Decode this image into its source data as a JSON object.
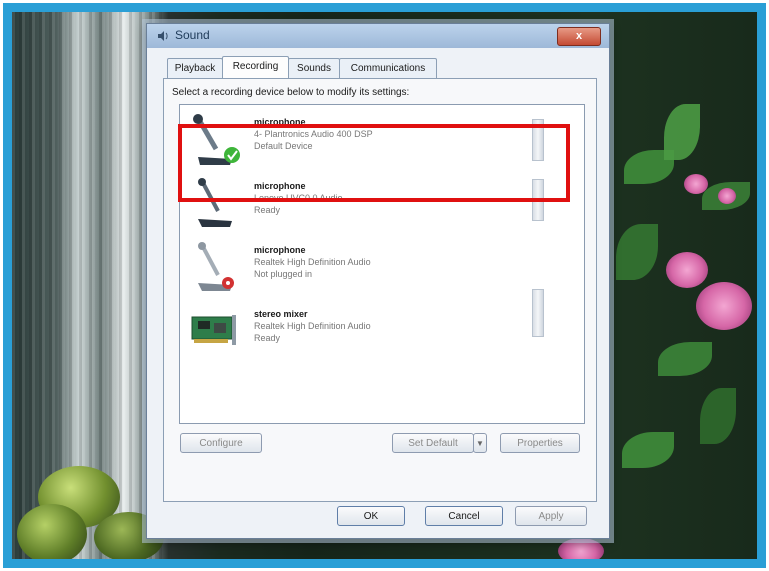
{
  "window": {
    "title": "Sound",
    "close_glyph": "x"
  },
  "tabs": [
    {
      "label": "Playback"
    },
    {
      "label": "Recording"
    },
    {
      "label": "Sounds"
    },
    {
      "label": "Communications"
    }
  ],
  "recording": {
    "instruction": "Select a recording device below to modify its settings:",
    "devices": [
      {
        "name": "microphone",
        "description": "4- Plantronics Audio 400 DSP",
        "status": "Default Device"
      },
      {
        "name": "microphone",
        "description": "Lenovo UVC0.0 Audio",
        "status": "Ready"
      },
      {
        "name": "microphone",
        "description": "Realtek High Definition Audio",
        "status": "Not plugged in"
      },
      {
        "name": "stereo mixer",
        "description": "Realtek High Definition Audio",
        "status": "Ready"
      }
    ]
  },
  "buttons": {
    "configure": "Configure",
    "set_default": "Set Default",
    "properties": "Properties",
    "ok": "OK",
    "cancel": "Cancel",
    "apply": "Apply"
  },
  "icons": {
    "window": "speaker-icon",
    "default_badge": "green-check-icon",
    "unplugged_badge": "red-circle-icon",
    "dropdown": "chevron-down-icon"
  },
  "colors": {
    "highlight": "#e01010",
    "frame": "#2a9fd6"
  }
}
